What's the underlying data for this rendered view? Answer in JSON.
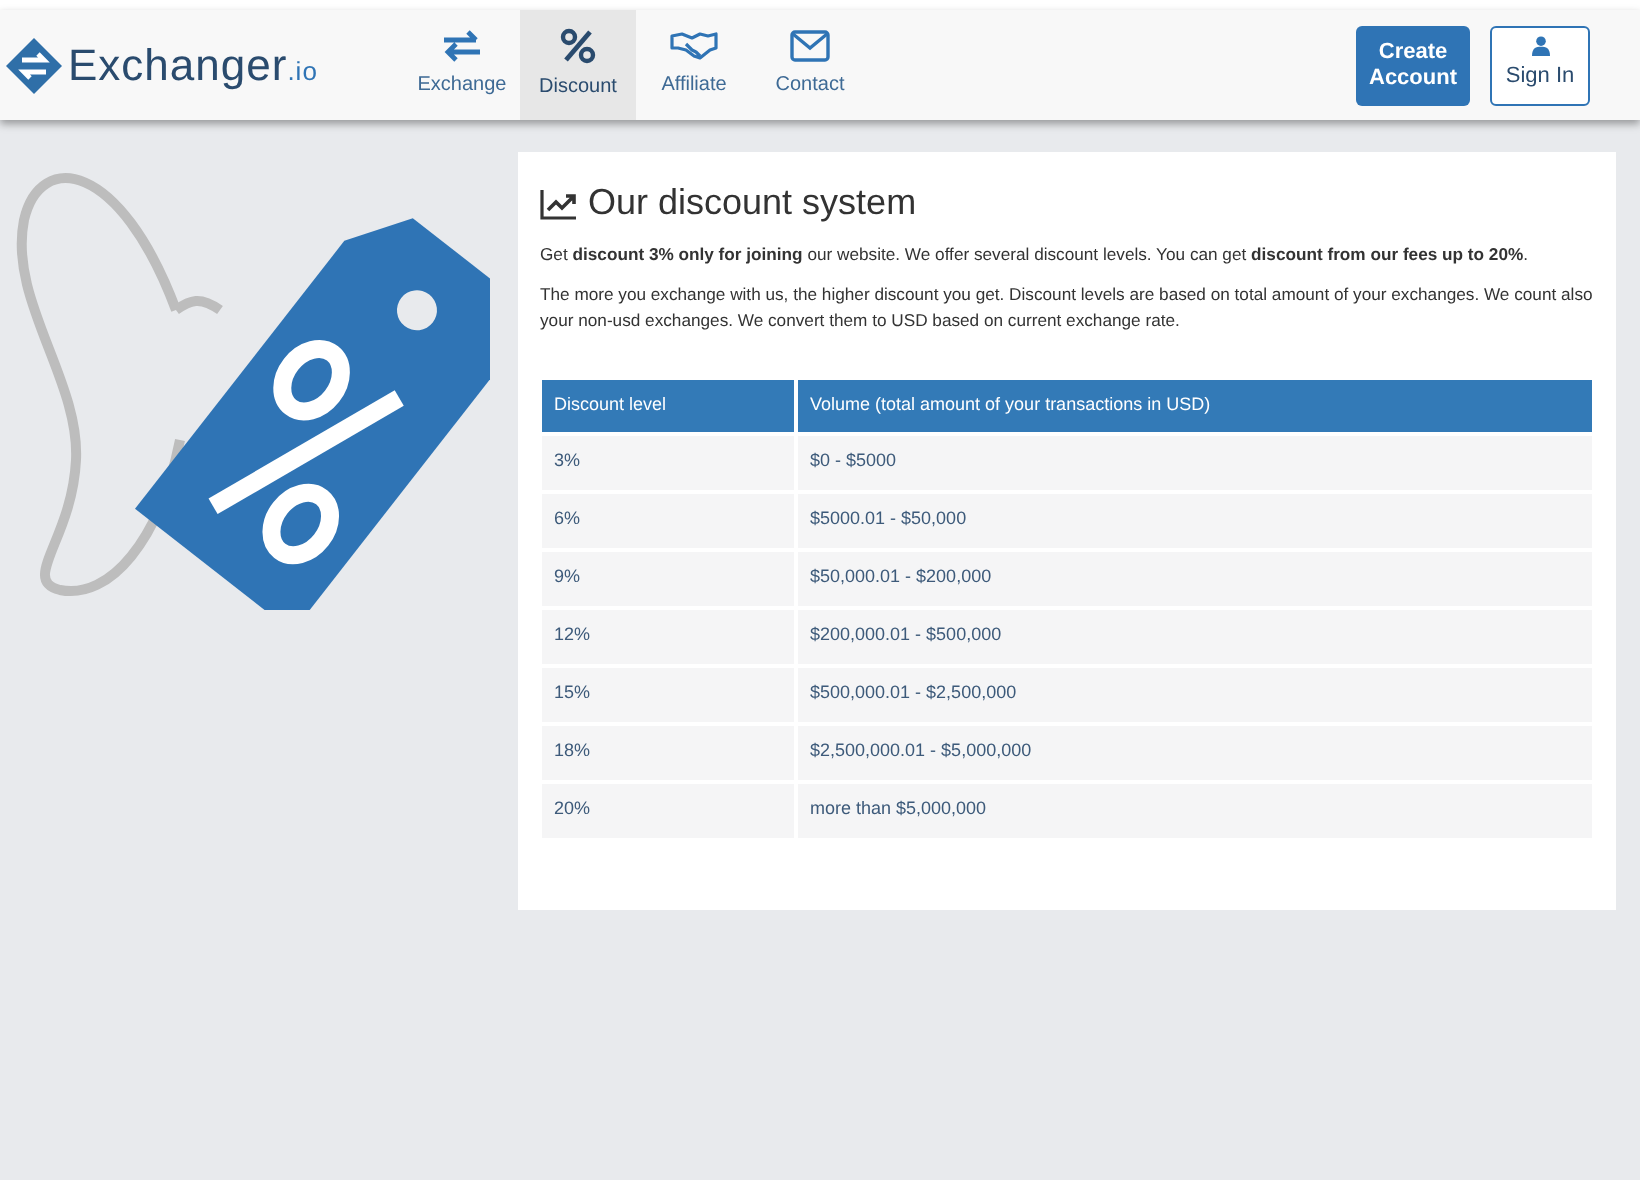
{
  "logo": {
    "name": "Exchanger",
    "suffix": ".io"
  },
  "nav": [
    {
      "label": "Exchange",
      "kind": "arrows",
      "selected": false
    },
    {
      "label": "Discount",
      "kind": "percent",
      "selected": true
    },
    {
      "label": "Affiliate",
      "kind": "handshake",
      "selected": false
    },
    {
      "label": "Contact",
      "kind": "mail",
      "selected": false
    }
  ],
  "buttons": [
    {
      "label": "Create Account",
      "kind": "primary"
    },
    {
      "label": "Sign In",
      "kind": "outline"
    }
  ],
  "title": "Our discount system",
  "paragraphs": [
    "Get **discount 3% only for joining** our website. We offer several discount levels. You can get **discount from our fees up to 20%**.",
    "The more you exchange with us, the higher discount you get. Discount levels are based on total amount of your exchanges. We count also your non-usd exchanges. We convert them to USD based on current exchange rate."
  ],
  "table": {
    "columns": [
      "Discount level",
      "Volume (total amount of your transactions in USD)"
    ],
    "rows": [
      [
        "3%",
        "$0 - $5000"
      ],
      [
        "6%",
        "$5000.01 - $50,000"
      ],
      [
        "9%",
        "$50,000.01 - $200,000"
      ],
      [
        "12%",
        "$200,000.01 - $500,000"
      ],
      [
        "15%",
        "$500,000.01 - $2,500,000"
      ],
      [
        "18%",
        "$2,500,000.01 - $5,000,000"
      ],
      [
        "20%",
        "more than $5,000,000"
      ]
    ]
  }
}
